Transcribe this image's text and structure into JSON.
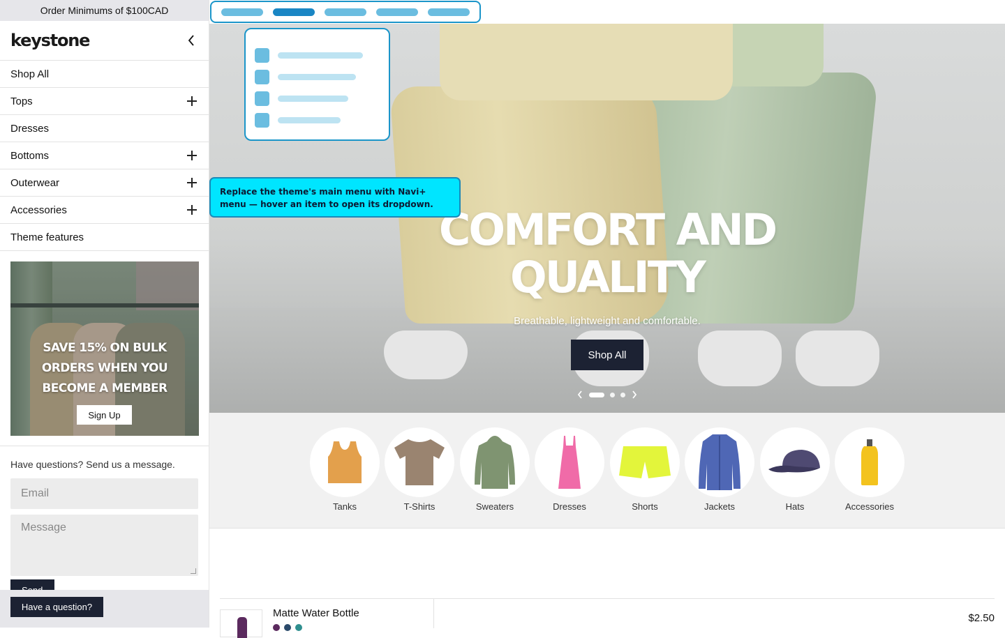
{
  "announcement": "Order Minimums of $100CAD",
  "brand": {
    "logo": "keystone"
  },
  "sidebar": {
    "nav_items": [
      {
        "label": "Shop All",
        "expandable": false
      },
      {
        "label": "Tops",
        "expandable": true
      },
      {
        "label": "Dresses",
        "expandable": false
      },
      {
        "label": "Bottoms",
        "expandable": true
      },
      {
        "label": "Outerwear",
        "expandable": true
      },
      {
        "label": "Accessories",
        "expandable": true
      },
      {
        "label": "Theme features",
        "expandable": false
      }
    ],
    "promo": {
      "line1": "SAVE 15% ON BULK",
      "line2": "ORDERS WHEN YOU",
      "line3": "BECOME A MEMBER",
      "button": "Sign Up"
    },
    "contact": {
      "label": "Have questions? Send us a message.",
      "email_placeholder": "Email",
      "message_placeholder": "Message",
      "send_label": "Send"
    },
    "question_button": "Have a question?"
  },
  "navi_overlay": {
    "callout": "Replace the theme's main menu with Navi+ menu — hover an item to open its dropdown.",
    "menu_pill_count": 5,
    "active_pill_index": 1,
    "dropdown_item_count": 4,
    "accent_color": "#1b95c9",
    "callout_color": "#00e5ff"
  },
  "hero": {
    "title_line1": "COMFORT AND",
    "title_line2": "QUALITY",
    "subtitle": "Breathable, lightweight and comfortable.",
    "button": "Shop All",
    "slide_count": 3,
    "active_slide": 1
  },
  "categories": [
    {
      "label": "Tanks",
      "icon": "tank-top-icon",
      "color": "#e3a04c"
    },
    {
      "label": "T-Shirts",
      "icon": "tshirt-icon",
      "color": "#9a8470"
    },
    {
      "label": "Sweaters",
      "icon": "hoodie-icon",
      "color": "#7f9471"
    },
    {
      "label": "Dresses",
      "icon": "dress-icon",
      "color": "#f06ba8"
    },
    {
      "label": "Shorts",
      "icon": "shorts-icon",
      "color": "#e3f53b"
    },
    {
      "label": "Jackets",
      "icon": "jacket-icon",
      "color": "#4f67b5"
    },
    {
      "label": "Hats",
      "icon": "cap-icon",
      "color": "#4f4a72"
    },
    {
      "label": "Accessories",
      "icon": "water-bottle-icon",
      "color": "#f3c31e"
    }
  ],
  "product": {
    "name": "Matte Water Bottle",
    "price": "$2.50"
  },
  "colors": {
    "dark_button": "#1c2233",
    "announcement_bg": "#e6e6ea"
  }
}
